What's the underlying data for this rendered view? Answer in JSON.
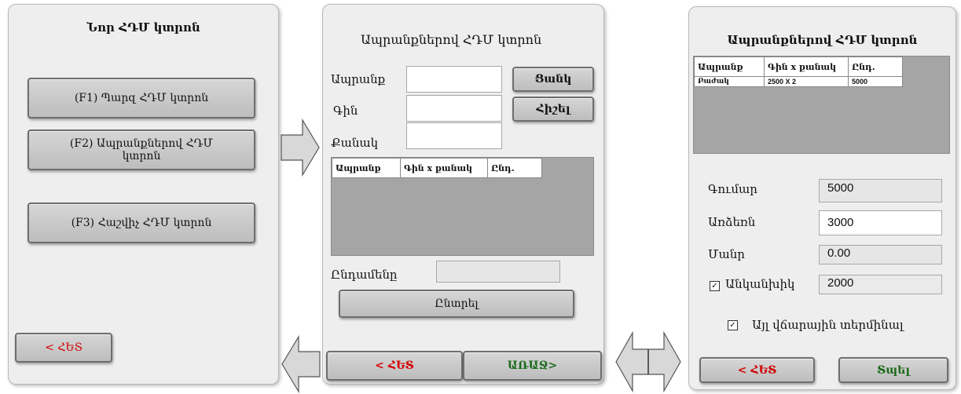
{
  "panel1": {
    "title": "Նոր ՀԴՄ կտրոն",
    "btn_simple": "(F1) Պարզ ՀԴՄ կտրոն",
    "btn_products": "(F2) Ապրանքներով ՀԴՄ կտրոն",
    "btn_bill": "(F3) Հաշվիչ ՀԴՄ կտրոն",
    "btn_back": "< ՀԵՏ"
  },
  "panel2": {
    "title": "Ապրանքներով ՀԴՄ կտրոն",
    "label_product": "Ապրանք",
    "label_price": "Գին",
    "label_qty": "Քանակ",
    "btn_add": "Ցանկ",
    "btn_calc": "Հիշել",
    "grid_headers": [
      "Ապրանք",
      "Գին x քանակ",
      "Ընդ."
    ],
    "label_total": "Ընդամենը",
    "btn_select": "Ընտրել",
    "btn_back": "< ՀԵՏ",
    "btn_next": "ԱՌԱՋ>"
  },
  "panel3": {
    "title": "Ապրանքներով ՀԴՄ կտրոն",
    "grid_headers": [
      "Ապրանք",
      "Գին x քանակ",
      "Ընդ."
    ],
    "grid_rows": [
      [
        "Բաժակ",
        "2500 X 2",
        "5000"
      ]
    ],
    "label_sum": "Գումար",
    "value_sum": "5000",
    "label_cash": "Առձեռն",
    "value_cash": "3000",
    "label_change": "Մանր",
    "value_change": "0.00",
    "label_cashless": "Անկանխիկ",
    "value_cashless": "2000",
    "cashless_checked": true,
    "label_other_terminal": "Այլ վճարային տերմինալ",
    "other_terminal_checked": true,
    "btn_back": "< ՀԵՏ",
    "btn_print": "Տպել"
  },
  "colors": {
    "back_text": "#d40000",
    "forward_text": "#1c6b1c",
    "panel_bg": "#eeeeee",
    "grid_bg": "#a5a5a5"
  }
}
